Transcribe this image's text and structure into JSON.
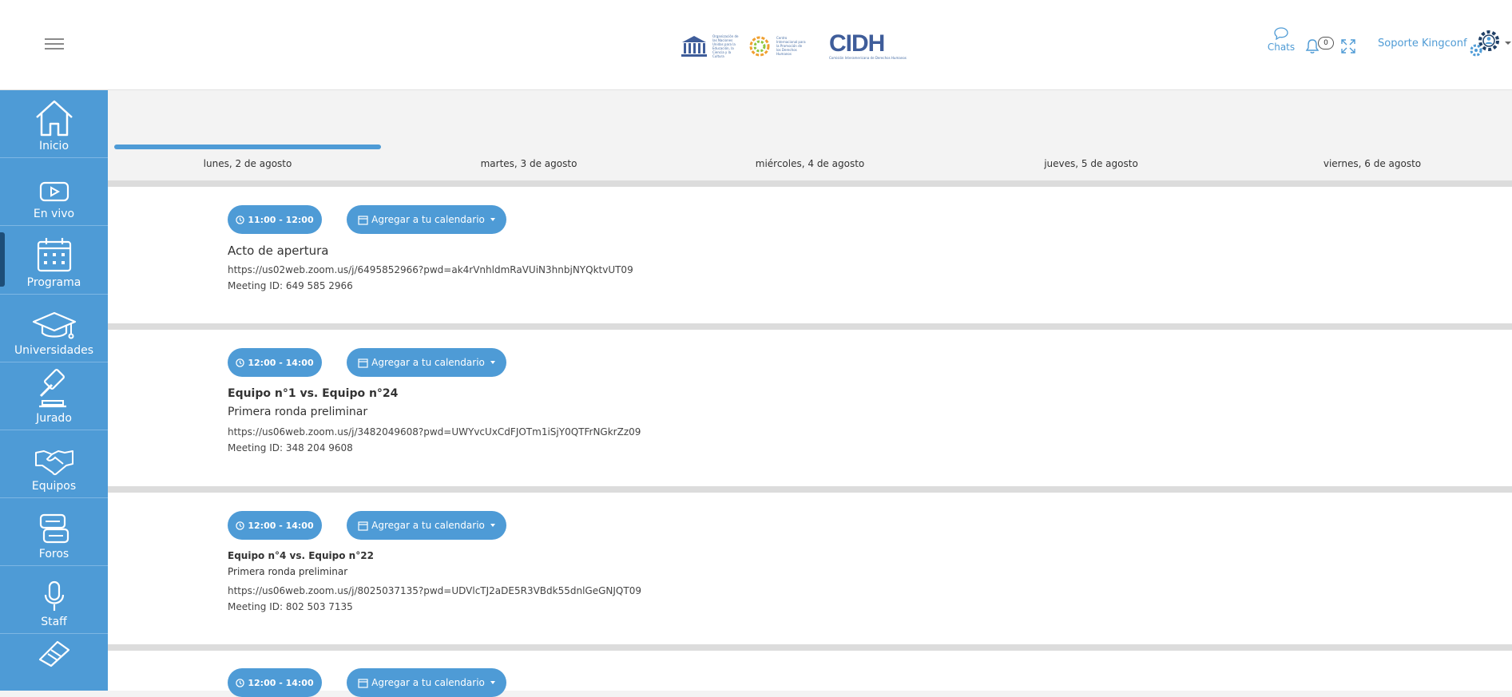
{
  "header": {
    "logo_unesco_text": "Organización de las Naciones Unidas para la Educación, la Ciencia y la Cultura",
    "logo_cipdh_text": "Centro Internacional para la Promoción de los Derechos Humanos",
    "logo_cidh": "CIDH",
    "logo_cidh_sub": "Comisión Interamericana de Derechos Humanos",
    "chats_label": "Chats",
    "notifications_count": "0",
    "support_label": "Soporte Kingconf"
  },
  "sidebar": {
    "items": [
      {
        "label": "Inicio",
        "icon": "home-icon"
      },
      {
        "label": "En vivo",
        "icon": "live-video-icon"
      },
      {
        "label": "Programa",
        "icon": "calendar-icon"
      },
      {
        "label": "Universidades",
        "icon": "graduation-cap-icon"
      },
      {
        "label": "Jurado",
        "icon": "gavel-icon"
      },
      {
        "label": "Equipos",
        "icon": "handshake-icon"
      },
      {
        "label": "Foros",
        "icon": "forum-icon"
      },
      {
        "label": "Staff",
        "icon": "microphone-icon"
      },
      {
        "label": "",
        "icon": "book-icon"
      }
    ],
    "active": "Programa"
  },
  "days": [
    "lunes, 2 de agosto",
    "martes, 3 de agosto",
    "miércoles, 4 de agosto",
    "jueves, 5 de agosto",
    "viernes, 6 de agosto"
  ],
  "calendar_button_label": "Agregar a tu calendario",
  "sessions": [
    {
      "time": "11:00 - 12:00",
      "title": "",
      "subtitle": "Acto de apertura",
      "link": "https://us02web.zoom.us/j/6495852966?pwd=ak4rVnhldmRaVUiN3hnbjNYQktvUT09",
      "meeting_id": "Meeting ID: 649 585 2966"
    },
    {
      "time": "12:00 - 14:00",
      "title": "Equipo n°1 vs. Equipo n°24",
      "subtitle": "Primera ronda preliminar",
      "link": "https://us06web.zoom.us/j/3482049608?pwd=UWYvcUxCdFJOTm1iSjY0QTFrNGkrZz09",
      "meeting_id": "Meeting ID: 348 204 9608"
    },
    {
      "time": "12:00 - 14:00",
      "title": "Equipo n°4  vs. Equipo n°22",
      "subtitle": "Primera ronda preliminar",
      "link": "https://us06web.zoom.us/j/8025037135?pwd=UDVlcTJ2aDE5R3VBdk55dnlGeGNJQT09",
      "meeting_id": "Meeting ID: 802 503 7135"
    },
    {
      "time": "12:00 - 14:00",
      "title": "",
      "subtitle": "",
      "link": "",
      "meeting_id": ""
    }
  ],
  "colors": {
    "accent": "#4e9bd6",
    "sidebar_active_marker": "#1d4e78"
  }
}
